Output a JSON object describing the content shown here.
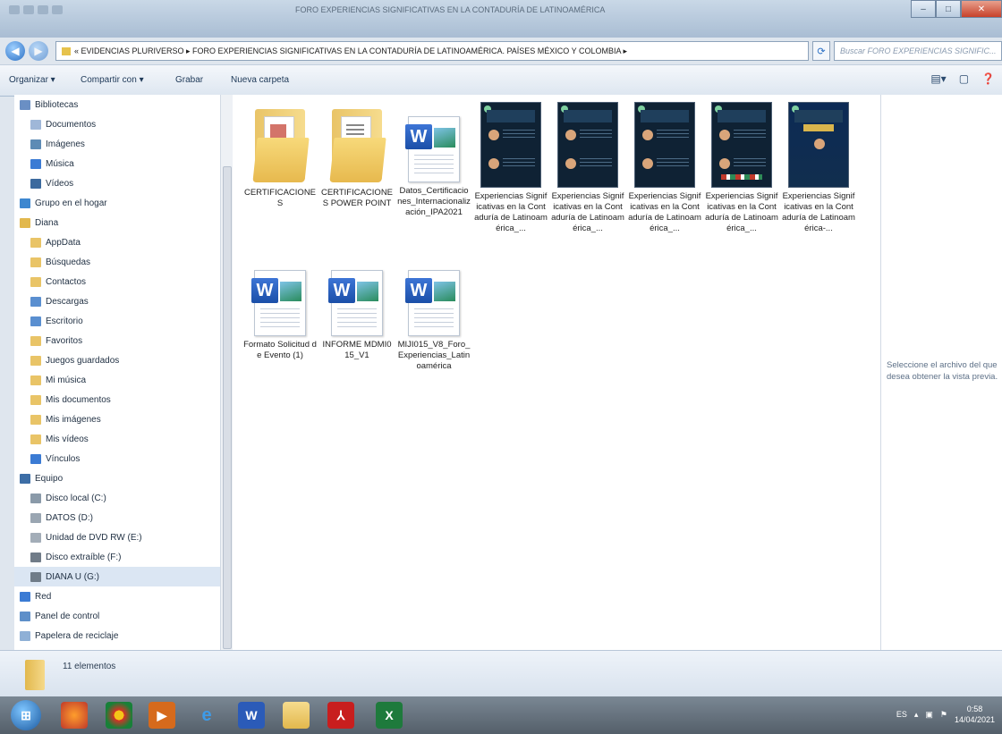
{
  "window": {
    "title": "FORO EXPERIENCIAS SIGNIFICATIVAS EN LA CONTADURÍA DE LATINOAMÉRICA",
    "controls": {
      "minimize": "–",
      "maximize": "□",
      "close": "✕"
    }
  },
  "address_bar": {
    "path": "« EVIDENCIAS PLURIVERSO ▸ FORO EXPERIENCIAS SIGNIFICATIVAS EN LA CONTADURÍA DE LATINOAMÉRICA. PAÍSES MÉXICO Y COLOMBIA ▸",
    "search_placeholder": "Buscar FORO EXPERIENCIAS SIGNIFIC..."
  },
  "toolbar": {
    "organize": "Organizar ▾",
    "share": "Compartir con ▾",
    "burn": "Grabar",
    "new_folder": "Nueva carpeta"
  },
  "nav": {
    "items": [
      {
        "label": "Bibliotecas",
        "icon": "libraries-icon",
        "color": "#6a8fc4"
      },
      {
        "label": "Documentos",
        "icon": "documents-icon",
        "color": "#9fb7d8"
      },
      {
        "label": "Imágenes",
        "icon": "pictures-icon",
        "color": "#5d8bb5"
      },
      {
        "label": "Música",
        "icon": "music-icon",
        "color": "#3b7bd4"
      },
      {
        "label": "Vídeos",
        "icon": "videos-icon",
        "color": "#3c6a9e"
      },
      {
        "label": "Grupo en el hogar",
        "icon": "homegroup-icon",
        "color": "#3d87d0"
      },
      {
        "label": "Diana",
        "icon": "user-folder-icon",
        "color": "#e2b84d"
      },
      {
        "label": "AppData",
        "icon": "folder-icon",
        "color": "#e9c467"
      },
      {
        "label": "Búsquedas",
        "icon": "searches-icon",
        "color": "#e9c467"
      },
      {
        "label": "Contactos",
        "icon": "contacts-icon",
        "color": "#e9c467"
      },
      {
        "label": "Descargas",
        "icon": "downloads-icon",
        "color": "#5a8fd0"
      },
      {
        "label": "Escritorio",
        "icon": "desktop-icon",
        "color": "#5a8fd0"
      },
      {
        "label": "Favoritos",
        "icon": "favorites-icon",
        "color": "#e9c467"
      },
      {
        "label": "Juegos guardados",
        "icon": "saved-games-icon",
        "color": "#e9c467"
      },
      {
        "label": "Mi música",
        "icon": "my-music-icon",
        "color": "#e9c467"
      },
      {
        "label": "Mis documentos",
        "icon": "my-documents-icon",
        "color": "#e9c467"
      },
      {
        "label": "Mis imágenes",
        "icon": "my-pictures-icon",
        "color": "#e9c467"
      },
      {
        "label": "Mis vídeos",
        "icon": "my-videos-icon",
        "color": "#e9c467"
      },
      {
        "label": "Vínculos",
        "icon": "links-icon",
        "color": "#3b7bd4"
      },
      {
        "label": "Equipo",
        "icon": "computer-icon",
        "color": "#3d6ea6"
      },
      {
        "label": "Disco local (C:)",
        "icon": "drive-icon",
        "color": "#8a9aa9"
      },
      {
        "label": "DATOS (D:)",
        "icon": "drive-icon",
        "color": "#9aa6b2"
      },
      {
        "label": "Unidad de DVD RW (E:)",
        "icon": "dvd-drive-icon",
        "color": "#a3adb8"
      },
      {
        "label": "Disco extraíble (F:)",
        "icon": "removable-drive-icon",
        "color": "#707c88"
      },
      {
        "label": "DIANA U (G:)",
        "icon": "removable-drive-icon",
        "color": "#707c88",
        "selected": true
      },
      {
        "label": "Red",
        "icon": "network-icon",
        "color": "#3b7bd4"
      },
      {
        "label": "Panel de control",
        "icon": "control-panel-icon",
        "color": "#5e8fc9"
      },
      {
        "label": "Papelera de reciclaje",
        "icon": "recycle-bin-icon",
        "color": "#8fb0d6"
      }
    ]
  },
  "files": [
    {
      "name": "CERTIFICACIONES",
      "type": "folder"
    },
    {
      "name": "CERTIFICACIONES POWER POINT",
      "type": "folder"
    },
    {
      "name": "Datos_Certificaciones_Internacionalización_IPA2021",
      "type": "word"
    },
    {
      "name": "Experiencias Significativas en la Contaduría de Latinoamérica_...",
      "type": "image"
    },
    {
      "name": "Experiencias Significativas en la Contaduría de Latinoamérica_...",
      "type": "image"
    },
    {
      "name": "Experiencias Significativas en la Contaduría de Latinoamérica_...",
      "type": "image"
    },
    {
      "name": "Experiencias Significativas en la Contaduría de Latinoamérica_...",
      "type": "image"
    },
    {
      "name": "Experiencias Significativas en la Contaduría de Latinoamérica-...",
      "type": "image"
    },
    {
      "name": "Formato Solicitud de Evento (1)",
      "type": "word"
    },
    {
      "name": "INFORME MDMI015_V1",
      "type": "word"
    },
    {
      "name": "MIJI015_V8_Foro_Experiencias_Latinoamérica",
      "type": "word"
    }
  ],
  "preview_pane": {
    "message_line1": "Seleccione el archivo del que",
    "message_line2": "desea obtener la vista previa."
  },
  "status": {
    "count": "11 elementos"
  },
  "taskbar": {
    "language": "ES",
    "time": "0:58",
    "date": "14/04/2021"
  }
}
